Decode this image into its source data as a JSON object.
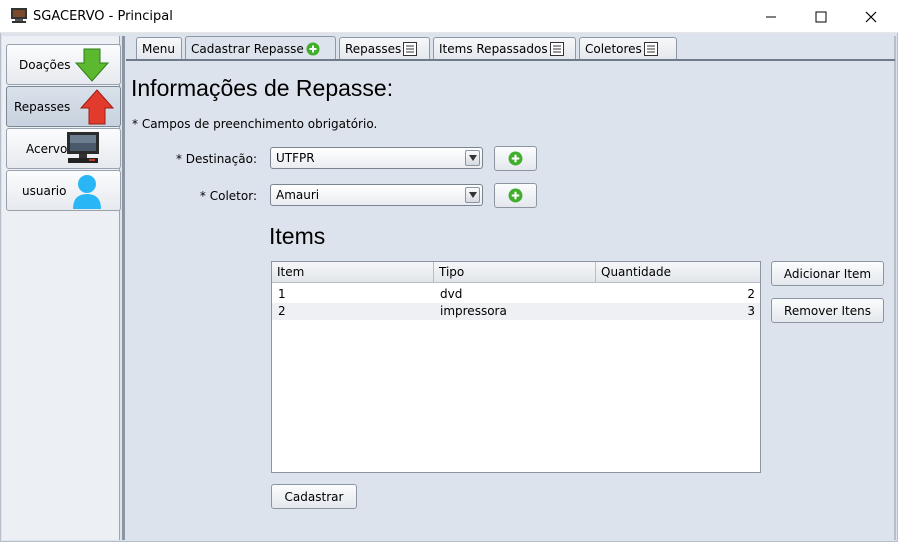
{
  "window": {
    "title": "SGACERVO - Principal"
  },
  "sidebar": {
    "items": [
      {
        "label": "Doações",
        "icon": "green-down-arrow-icon"
      },
      {
        "label": "Repasses",
        "icon": "red-up-arrow-icon",
        "active": true
      },
      {
        "label": "Acervo",
        "icon": "computer-icon"
      },
      {
        "label": "usuario",
        "icon": "user-icon"
      }
    ]
  },
  "tabs": [
    {
      "label": "Menu"
    },
    {
      "label": "Cadastrar Repasse",
      "icon": "plus-icon",
      "active": true
    },
    {
      "label": "Repasses",
      "icon": "list-icon"
    },
    {
      "label": "Items Repassados",
      "icon": "list-icon"
    },
    {
      "label": "Coletores",
      "icon": "list-icon"
    }
  ],
  "form": {
    "heading": "Informações de Repasse:",
    "required_note": "* Campos de preenchimento obrigatório.",
    "destinacao": {
      "label": "* Destinação:",
      "value": "UTFPR"
    },
    "coletor": {
      "label": "* Coletor:",
      "value": "Amauri"
    }
  },
  "items": {
    "title": "Items",
    "columns": [
      "Item",
      "Tipo",
      "Quantidade"
    ],
    "rows": [
      {
        "item": "1",
        "tipo": "dvd",
        "quantidade": "2"
      },
      {
        "item": "2",
        "tipo": "impressora",
        "quantidade": "3"
      }
    ],
    "add_label": "Adicionar Item",
    "remove_label": "Remover Itens"
  },
  "submit_label": "Cadastrar",
  "colors": {
    "accent_green": "#4caf50",
    "accent_red": "#e53935",
    "user_blue": "#29b6f6",
    "panel_bg": "#dde3ec"
  }
}
